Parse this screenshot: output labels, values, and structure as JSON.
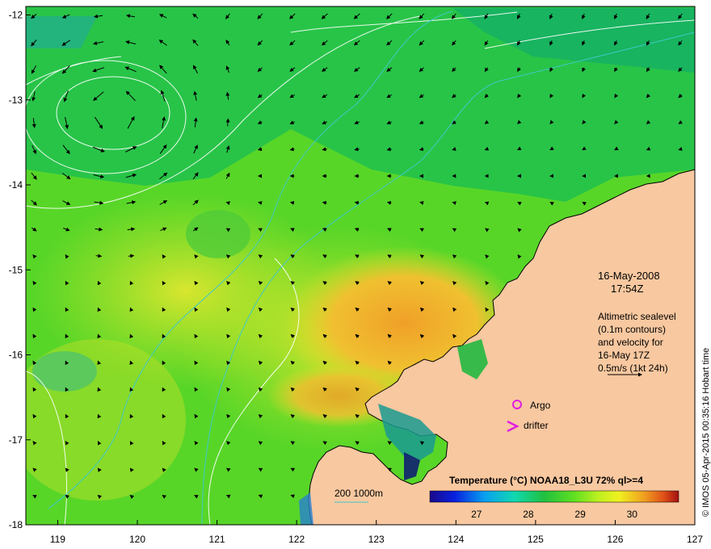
{
  "map": {
    "lon_range": [
      118.6,
      127.0
    ],
    "lat_range": [
      -18.0,
      -11.9
    ],
    "lon_ticks": [
      "119",
      "120",
      "121",
      "122",
      "123",
      "124",
      "125",
      "126",
      "127"
    ],
    "lat_ticks": [
      "-12",
      "-13",
      "-14",
      "-15",
      "-16",
      "-17",
      "-18"
    ]
  },
  "annotations": {
    "date": "16-May-2008",
    "time": "17:54Z",
    "altimetric_lines": [
      "Altimetric sealevel",
      "(0.1m contours)",
      "and velocity for",
      "16-May 17Z",
      "0.5m/s (1kt 24h)"
    ],
    "argo_label": "Argo",
    "drifter_label": "drifter",
    "bathymetry_label": "200  1000m"
  },
  "colorbar": {
    "title": "Temperature (°C) NOAA18_L3U 72% ql>=4",
    "ticks": [
      "27",
      "28",
      "29",
      "30"
    ],
    "tick_values": [
      27,
      28,
      29,
      30
    ],
    "range": [
      26.1,
      30.9
    ]
  },
  "credit": "© IMOS 05-Apr-2015 00:35:16 Hobart time",
  "colors": {
    "land": "#f8c8a0",
    "missing_data": "#ffffff",
    "sst_warm": "#f0a020",
    "sst_mid": "#9ae020",
    "sst_cool": "#22c060",
    "bathymetry": "#40c8c8",
    "argo_marker": "#e020e0"
  }
}
